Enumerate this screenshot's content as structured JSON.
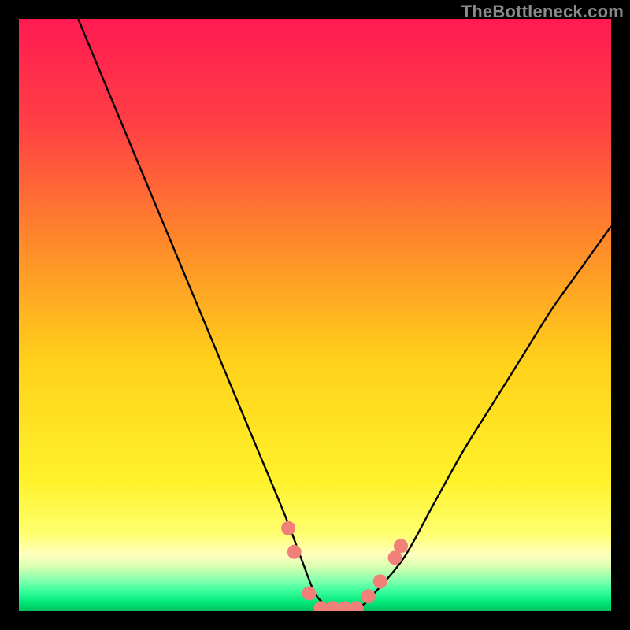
{
  "watermark": "TheBottleneck.com",
  "chart_data": {
    "type": "line",
    "title": "",
    "xlabel": "",
    "ylabel": "",
    "xlim": [
      0,
      100
    ],
    "ylim": [
      0,
      100
    ],
    "series": [
      {
        "name": "bottleneck-curve",
        "x": [
          10,
          15,
          20,
          25,
          30,
          35,
          40,
          45,
          48,
          50,
          52,
          55,
          58,
          60,
          65,
          70,
          75,
          80,
          85,
          90,
          95,
          100
        ],
        "values": [
          100,
          88,
          76,
          64,
          52,
          40,
          28,
          16,
          8,
          3,
          1,
          0,
          1,
          3,
          9,
          18,
          27,
          35,
          43,
          51,
          58,
          65
        ]
      }
    ],
    "markers": {
      "name": "highlight-dots",
      "color": "#f08078",
      "points": [
        {
          "x": 45.5,
          "y": 14
        },
        {
          "x": 46.5,
          "y": 10
        },
        {
          "x": 49.0,
          "y": 3
        },
        {
          "x": 51.0,
          "y": 0.5
        },
        {
          "x": 53.0,
          "y": 0.5
        },
        {
          "x": 55.0,
          "y": 0.5
        },
        {
          "x": 57.0,
          "y": 0.5
        },
        {
          "x": 59.0,
          "y": 2.5
        },
        {
          "x": 61.0,
          "y": 5
        },
        {
          "x": 63.5,
          "y": 9
        },
        {
          "x": 64.5,
          "y": 11
        }
      ]
    },
    "gradient_stops": [
      {
        "pos": 0.0,
        "color": "#ff1a52"
      },
      {
        "pos": 0.18,
        "color": "#ff4044"
      },
      {
        "pos": 0.38,
        "color": "#ff8a2a"
      },
      {
        "pos": 0.58,
        "color": "#ffd21a"
      },
      {
        "pos": 0.78,
        "color": "#fff22a"
      },
      {
        "pos": 0.87,
        "color": "#ffff70"
      },
      {
        "pos": 0.905,
        "color": "#ffffc0"
      },
      {
        "pos": 0.925,
        "color": "#d8ffb0"
      },
      {
        "pos": 0.945,
        "color": "#90ffb0"
      },
      {
        "pos": 0.965,
        "color": "#40ffa0"
      },
      {
        "pos": 0.985,
        "color": "#00e878"
      },
      {
        "pos": 1.0,
        "color": "#00c060"
      }
    ]
  }
}
